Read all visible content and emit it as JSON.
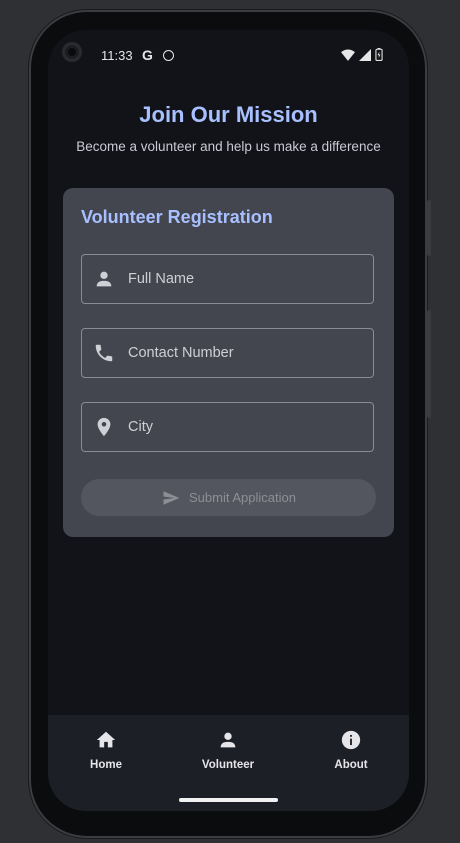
{
  "status_bar": {
    "time": "11:33",
    "google_icon": "G",
    "icons": [
      "google-icon",
      "face-icon",
      "wifi-icon",
      "signal-icon",
      "battery-icon"
    ]
  },
  "hero": {
    "title": "Join Our Mission",
    "subtitle": "Become a volunteer and help us make a difference"
  },
  "form": {
    "title": "Volunteer Registration",
    "fields": [
      {
        "icon": "person-icon",
        "placeholder": "Full Name",
        "value": ""
      },
      {
        "icon": "phone-icon",
        "placeholder": "Contact Number",
        "value": ""
      },
      {
        "icon": "location-pin-icon",
        "placeholder": "City",
        "value": ""
      }
    ],
    "submit_label": "Submit Application",
    "submit_icon": "send-icon"
  },
  "bottom_nav": {
    "items": [
      {
        "label": "Home",
        "icon": "home-icon"
      },
      {
        "label": "Volunteer",
        "icon": "person-icon"
      },
      {
        "label": "About",
        "icon": "info-icon"
      }
    ]
  },
  "colors": {
    "accent": "#a8c0ff",
    "background": "#121318",
    "card": "#43454f",
    "nav": "#1d1f26"
  }
}
